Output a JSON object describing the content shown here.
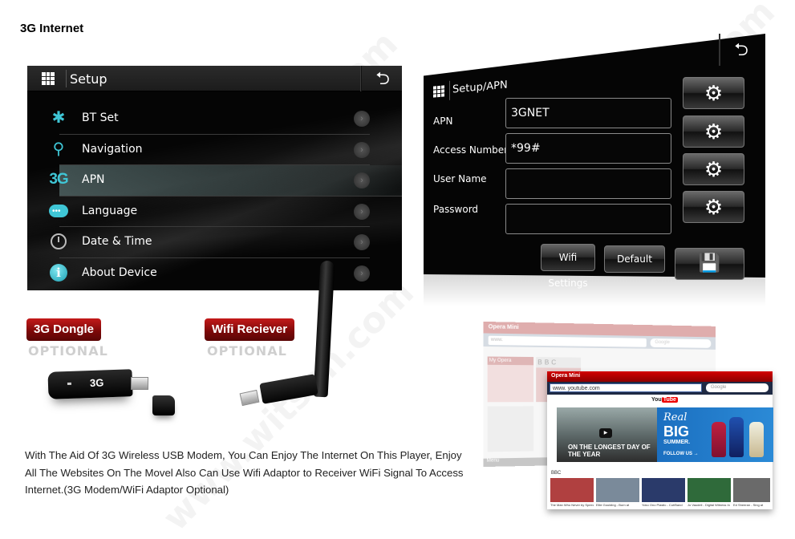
{
  "page": {
    "title": "3G Internet",
    "watermark": "www.witson.com"
  },
  "setup_screen": {
    "title": "Setup",
    "back_icon": "back-arrow-icon",
    "menu_items": [
      {
        "label": "BT Set",
        "icon": "bluetooth-icon",
        "glyph": "✱",
        "selected": false
      },
      {
        "label": "Navigation",
        "icon": "navigation-pin-icon",
        "glyph": "⚲",
        "selected": false
      },
      {
        "label": "APN",
        "icon": "3g-icon",
        "glyph": "3G",
        "selected": true
      },
      {
        "label": "Language",
        "icon": "chat-bubble-icon",
        "glyph": "",
        "selected": false
      },
      {
        "label": "Date & Time",
        "icon": "clock-icon",
        "glyph": "",
        "selected": false
      },
      {
        "label": "About Device",
        "icon": "info-icon",
        "glyph": "i",
        "selected": false
      }
    ],
    "chevron_glyph": "›"
  },
  "apn_screen": {
    "title": "Setup/APN",
    "fields": [
      {
        "label": "APN",
        "value": "3GNET"
      },
      {
        "label": "Access Number",
        "value": "*99#"
      },
      {
        "label": "User Name",
        "value": ""
      },
      {
        "label": "Password",
        "value": ""
      }
    ],
    "gear_glyph": "⚙",
    "buttons": {
      "wifi_settings": "Wifi Settings",
      "default": "Default",
      "save_glyph": "💾"
    },
    "back_glyph": "⮌"
  },
  "products": {
    "dongle": {
      "label": "3G Dongle",
      "note": "OPTIONAL",
      "device_text": "3G"
    },
    "wifi": {
      "label": "Wifi Reciever",
      "note": "OPTIONAL"
    }
  },
  "description": "With The Aid Of 3G Wireless USB Modem, You Can Enjoy The Internet On This Player, Enjoy All The Websites On The Movel Also Can Use Wifi Adaptor to Receiver WiFi Signal To Access Internet.(3G Modem/WiFi Adaptor Optional)",
  "browser_back": {
    "app_name": "Opera Mini",
    "url": "www.",
    "search_placeholder": "Google",
    "tile_my_opera": "My Opera",
    "tile_bbc": "BBC",
    "menu": "Menu"
  },
  "browser_front": {
    "app_name": "Opera Mini",
    "url": "www. youtube.com",
    "search_placeholder": "Google",
    "youtube_logo_left": "You",
    "youtube_logo_right": "Tube",
    "video_caption": "ON THE LONGEST DAY OF THE YEAR",
    "ad_line1": "Real",
    "ad_line2": "BIG",
    "ad_line3": "SUMMER.",
    "ad_cta": "FOLLOW US →",
    "channel": "BBC",
    "thumbnails": [
      {
        "caption": "The Man Who Never by Speech",
        "color": "#b04040"
      },
      {
        "caption": "Ellie Goulding - Burn at",
        "color": "#7a8a9a"
      },
      {
        "caption": "Yoko Ono Plastic - Cut/Band",
        "color": "#2a3a6a"
      },
      {
        "caption": "Jo Vaudeil - Digital Witness In",
        "color": "#2f6a3a"
      },
      {
        "caption": "Ed Sheeran - Sing at",
        "color": "#6a6a6a"
      }
    ]
  }
}
